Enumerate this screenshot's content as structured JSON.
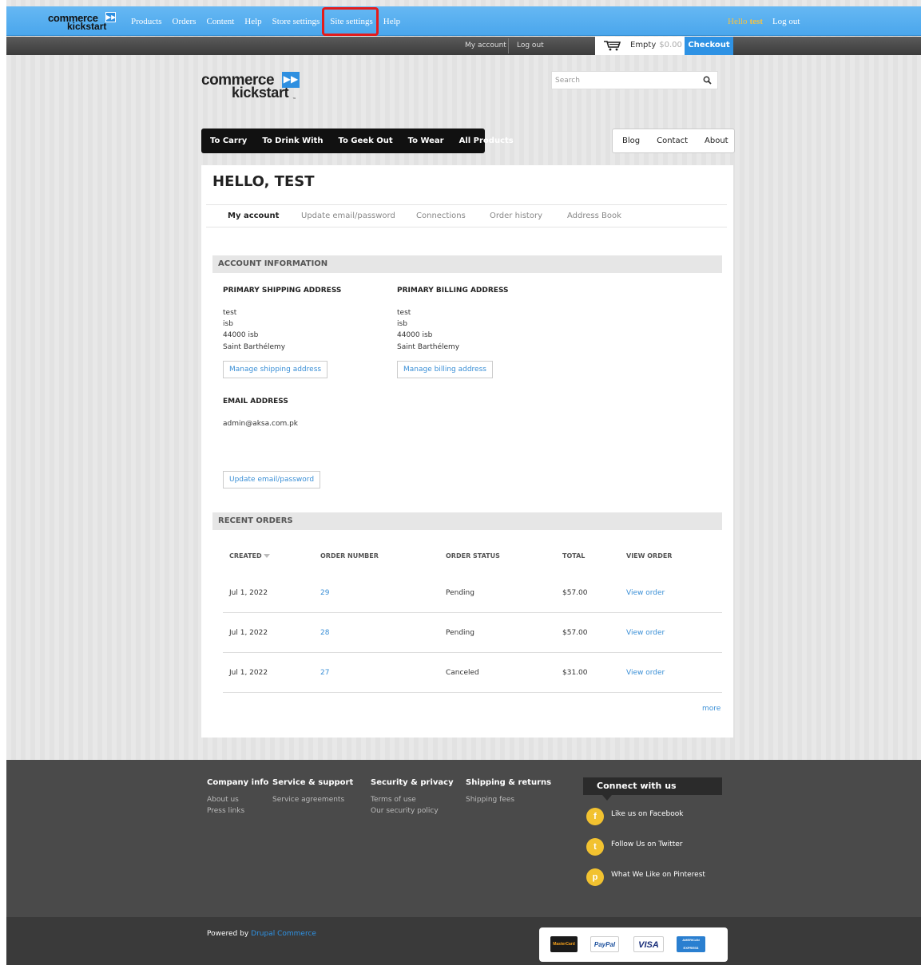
{
  "admin_bar": {
    "logo": {
      "line1": "commerce",
      "line2": "kickstart",
      "tm": "™"
    },
    "menu": [
      "Products",
      "Orders",
      "Content",
      "Help",
      "Store settings",
      "Site settings",
      "Help"
    ],
    "hello": "Hello",
    "username": "test",
    "logout": "Log out"
  },
  "user_bar": {
    "my_account": "My account",
    "logout": "Log out",
    "cart_empty": "Empty",
    "cart_amount": "$0.00",
    "checkout": "Checkout"
  },
  "site": {
    "logo": {
      "line1": "commerce",
      "line2": "kickstart",
      "tm": "™"
    },
    "search_placeholder": "Search",
    "main_nav": [
      "To Carry",
      "To Drink With",
      "To Geek Out",
      "To Wear",
      "All Products"
    ],
    "secondary_nav": [
      "Blog",
      "Contact",
      "About"
    ]
  },
  "account": {
    "title": "HELLO, TEST",
    "tabs": [
      "My account",
      "Update email/password",
      "Connections",
      "Order history",
      "Address Book"
    ],
    "active_tab": 0,
    "account_info_heading": "ACCOUNT INFORMATION",
    "shipping": {
      "heading": "PRIMARY SHIPPING ADDRESS",
      "lines": [
        "test",
        "isb",
        "44000 isb",
        "Saint Barthélemy"
      ],
      "button": "Manage shipping address"
    },
    "billing": {
      "heading": "PRIMARY BILLING ADDRESS",
      "lines": [
        "test",
        "isb",
        "44000 isb",
        "Saint Barthélemy"
      ],
      "button": "Manage billing address"
    },
    "email": {
      "heading": "EMAIL ADDRESS",
      "value": "admin@aksa.com.pk",
      "button": "Update email/password"
    },
    "recent_orders_heading": "RECENT ORDERS",
    "orders_columns": [
      "CREATED",
      "ORDER NUMBER",
      "ORDER STATUS",
      "TOTAL",
      "VIEW ORDER"
    ],
    "orders": [
      {
        "created": "Jul 1, 2022",
        "number": "29",
        "status": "Pending",
        "total": "$57.00",
        "view": "View order"
      },
      {
        "created": "Jul 1, 2022",
        "number": "28",
        "status": "Pending",
        "total": "$57.00",
        "view": "View order"
      },
      {
        "created": "Jul 1, 2022",
        "number": "27",
        "status": "Canceled",
        "total": "$31.00",
        "view": "View order"
      }
    ],
    "more": "more"
  },
  "footer": {
    "columns": [
      {
        "title": "Company info",
        "links": [
          "About us",
          "Press links"
        ]
      },
      {
        "title": "Service & support",
        "links": [
          "Service agreements"
        ]
      },
      {
        "title": "Security & privacy",
        "links": [
          "Terms of use",
          "Our security policy"
        ]
      },
      {
        "title": "Shipping & returns",
        "links": [
          "Shipping fees"
        ]
      }
    ],
    "connect_heading": "Connect with us",
    "social": [
      {
        "icon": "facebook-icon",
        "glyph": "f",
        "label": "Like us on Facebook"
      },
      {
        "icon": "twitter-icon",
        "glyph": "t",
        "label": "Follow Us on Twitter"
      },
      {
        "icon": "pinterest-icon",
        "glyph": "p",
        "label": "What We Like on Pinterest"
      }
    ],
    "powered_by": "Powered by",
    "powered_link": "Drupal Commerce",
    "payments": [
      {
        "icon": "mastercard-icon",
        "label": "MasterCard"
      },
      {
        "icon": "paypal-icon",
        "label": "PayPal"
      },
      {
        "icon": "visa-icon",
        "label": "VISA"
      },
      {
        "icon": "amex-icon",
        "label": "AMERICAN EXPRESS"
      }
    ]
  },
  "colors": {
    "admin_bar": "#4aa6ec",
    "highlight_box": "#e41b1b",
    "link": "#3a8fd6",
    "checkout": "#2e92e4",
    "social": "#f2c230"
  }
}
